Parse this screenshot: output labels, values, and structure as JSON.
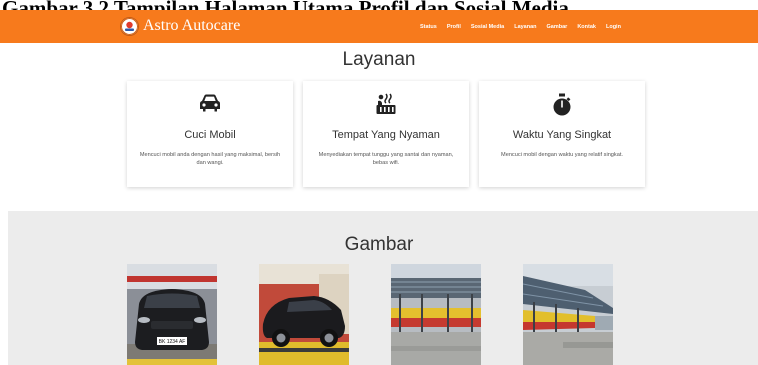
{
  "caption": "Gambar 3.2 Tampilan Halaman Utama Profil dan Sosial Media",
  "navbar": {
    "brand_name": "Astro Autocare",
    "links": [
      "Status",
      "Profil",
      "Sosial Media",
      "Layanan",
      "Gambar",
      "Kontak",
      "Login"
    ]
  },
  "services": {
    "title": "Layanan",
    "cards": [
      {
        "icon": "car-icon",
        "title": "Cuci Mobil",
        "description": "Mencuci mobil anda dengan hasil yang maksimal, bersih dan wangi."
      },
      {
        "icon": "hot-tub-icon",
        "title": "Tempat Yang Nyaman",
        "description": "Menyediakan tempat tunggu yang santai dan nyaman, bebas wifi."
      },
      {
        "icon": "stopwatch-icon",
        "title": "Waktu Yang Singkat",
        "description": "Mencuci mobil dengan waktu yang relatif singkat."
      }
    ]
  },
  "gallery": {
    "title": "Gambar",
    "photo_count": 4,
    "plate_text": "BK 1234 AF"
  },
  "colors": {
    "navbar": "#f77a1c",
    "gallery_background": "#ececec",
    "icon": "#222222"
  }
}
